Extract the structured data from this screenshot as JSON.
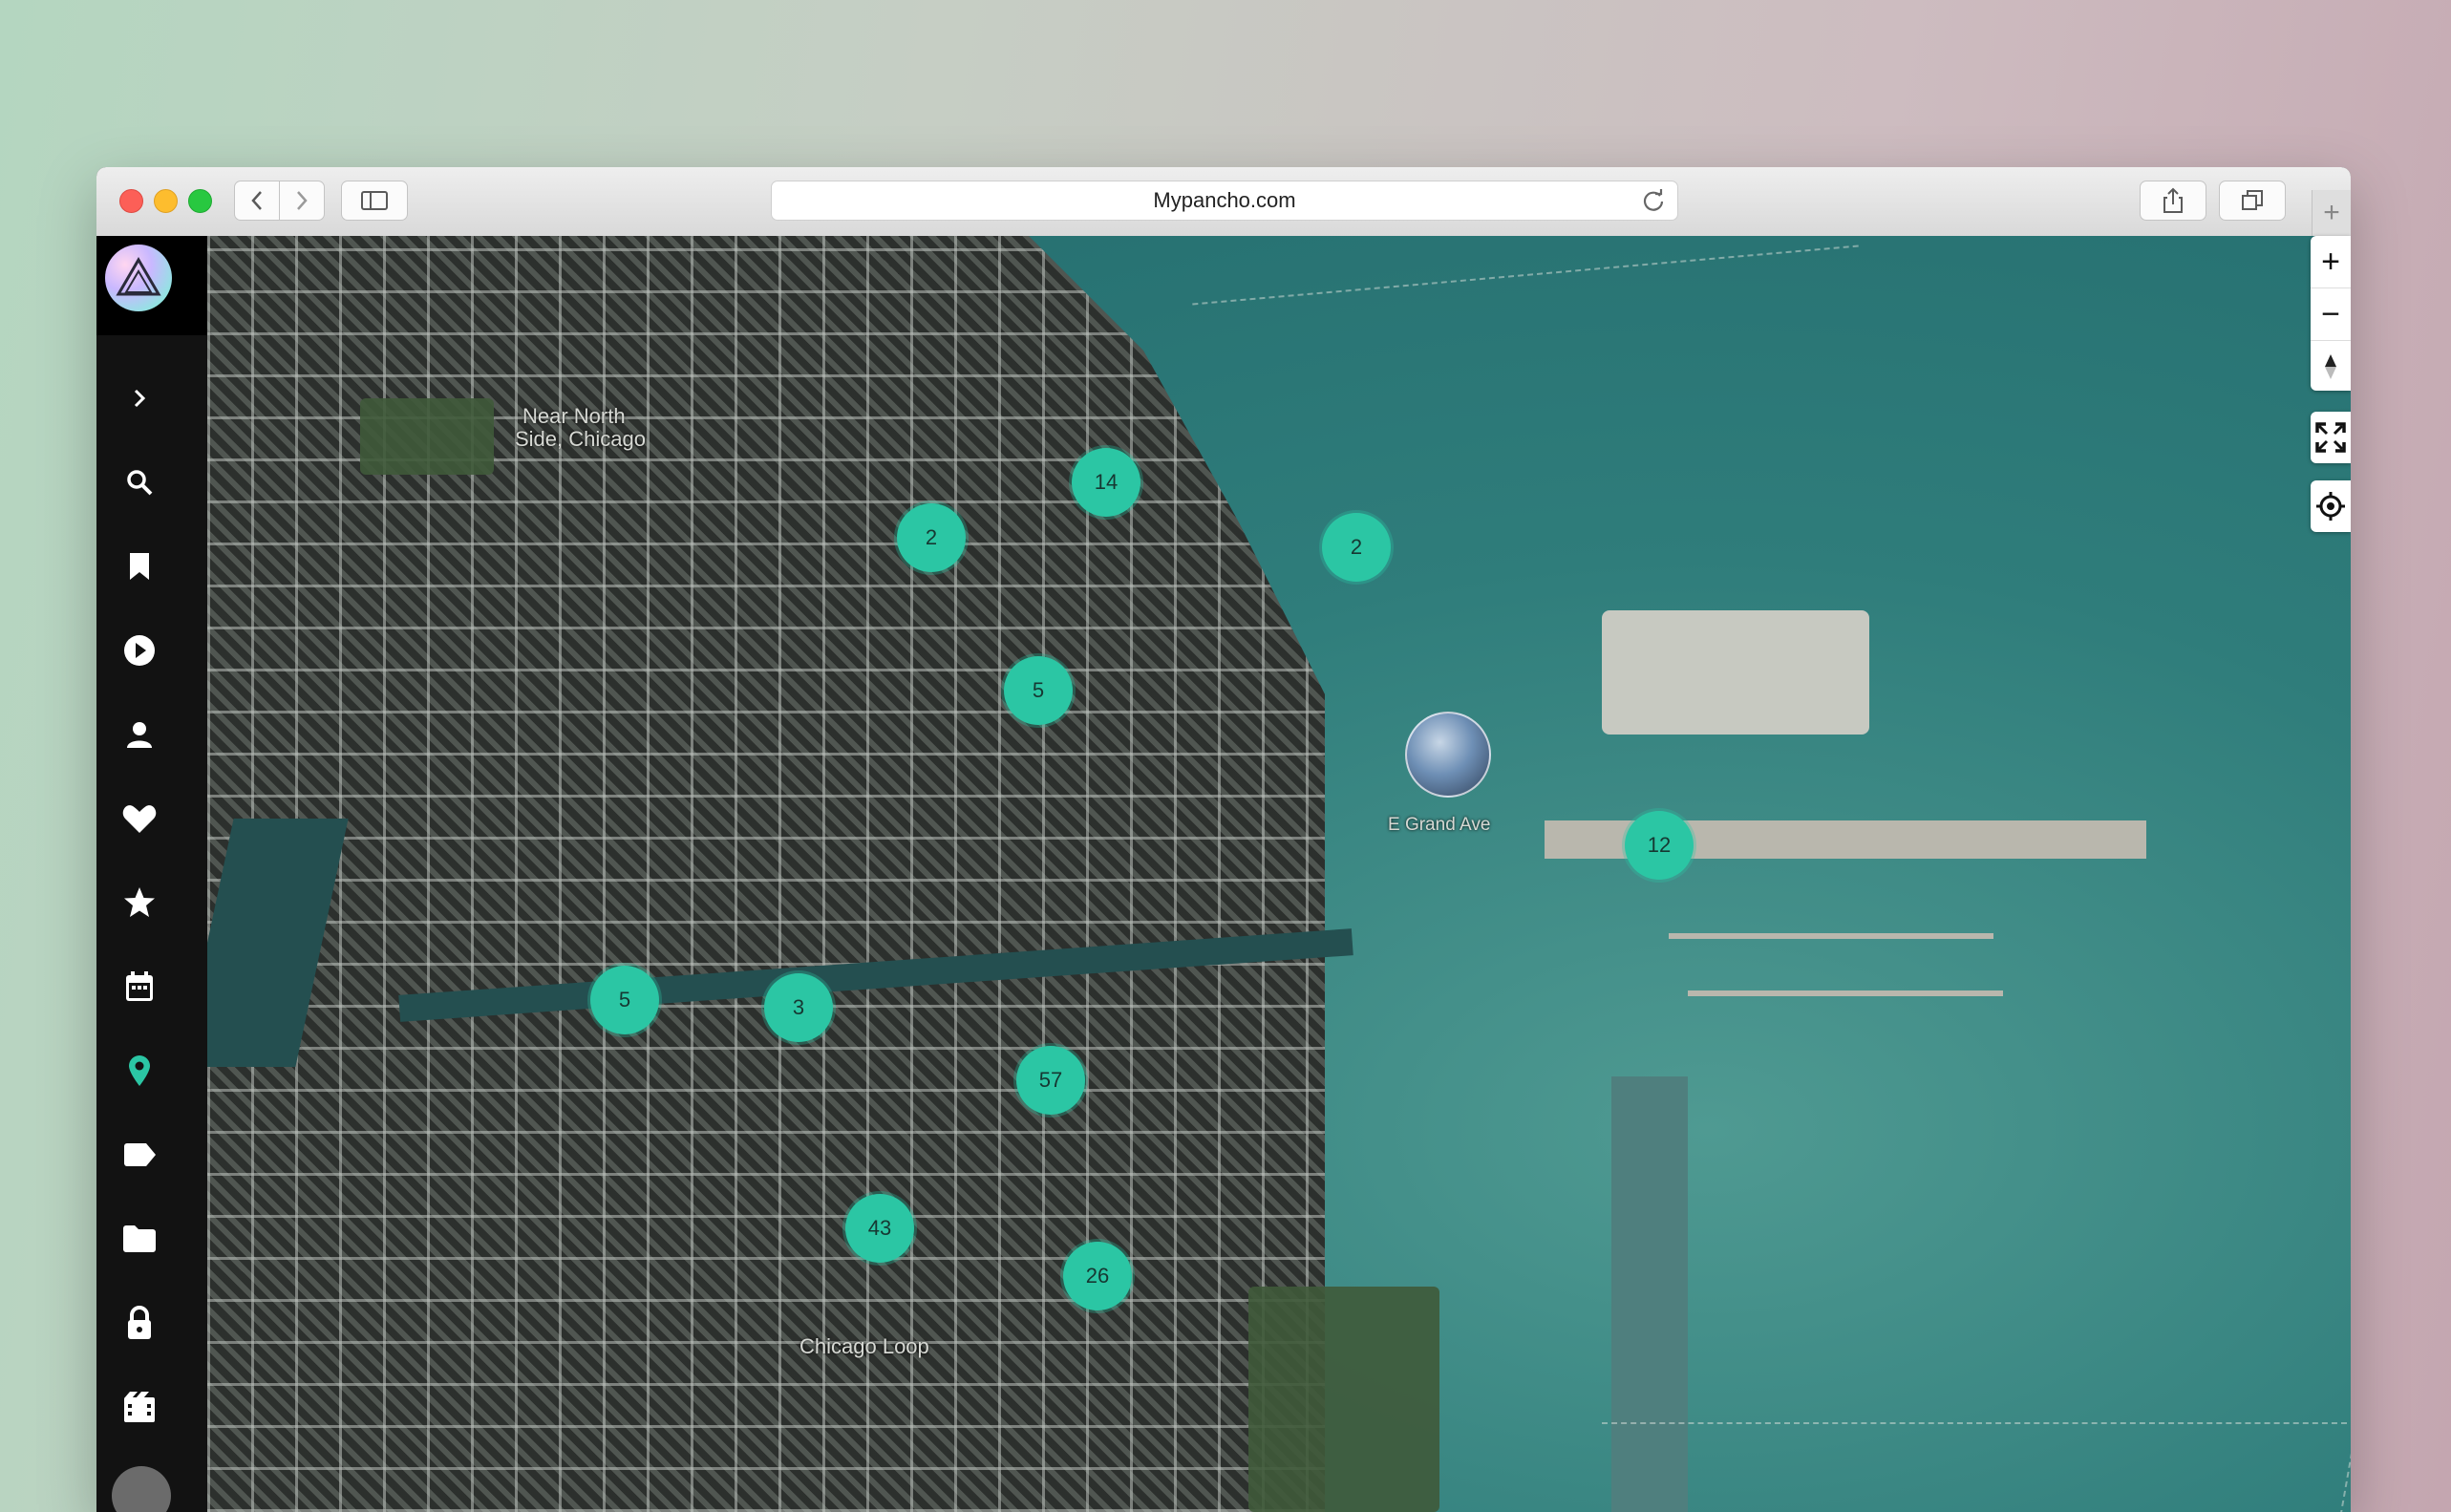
{
  "browser": {
    "url": "Mypancho.com",
    "buttons": [
      "back",
      "forward",
      "sidebar",
      "share",
      "tabs",
      "new-tab"
    ]
  },
  "sidebar": {
    "icons": [
      "chevron-right-icon",
      "search-icon",
      "bookmark-icon",
      "play-icon",
      "user-icon",
      "heart-icon",
      "star-icon",
      "calendar-icon",
      "map-pin-icon",
      "tag-icon",
      "folder-icon",
      "lock-icon",
      "film-icon"
    ],
    "accent": "#2bc6a4"
  },
  "map": {
    "labels": {
      "near_north_1": "Near North",
      "near_north_2": "Side, Chicago",
      "grand_ave": "E Grand Ave",
      "chicago_loop": "Chicago Loop"
    },
    "clusters": [
      {
        "id": "c1",
        "count": "14"
      },
      {
        "id": "c2",
        "count": "2"
      },
      {
        "id": "c3",
        "count": "2"
      },
      {
        "id": "c4",
        "count": "5"
      },
      {
        "id": "c5",
        "count": "12"
      },
      {
        "id": "c6",
        "count": "5"
      },
      {
        "id": "c7",
        "count": "3"
      },
      {
        "id": "c8",
        "count": "57"
      },
      {
        "id": "c9",
        "count": "43"
      },
      {
        "id": "c10",
        "count": "26"
      }
    ],
    "controls": {
      "zoom_in": "+",
      "zoom_out": "−"
    }
  }
}
